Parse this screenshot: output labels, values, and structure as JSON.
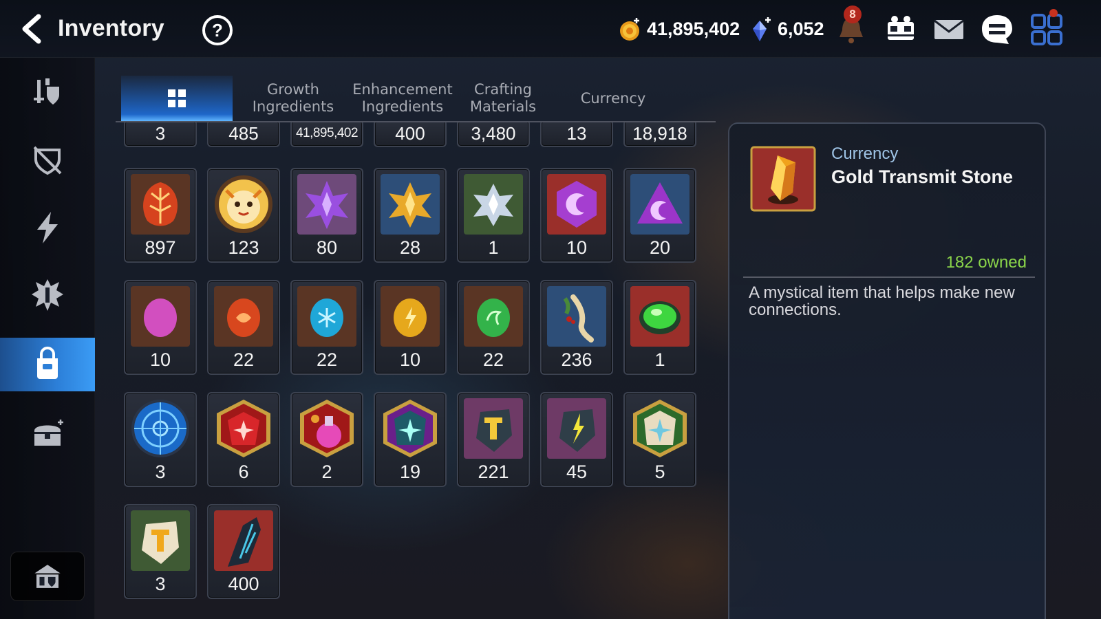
{
  "header": {
    "title": "Inventory",
    "gold": "41,895,402",
    "crystals": "6,052",
    "notification_count": "8"
  },
  "tabs": [
    {
      "label": "",
      "icon": "grid-all-icon",
      "active": true
    },
    {
      "label": "Growth\nIngredients"
    },
    {
      "label": "Enhancement\nIngredients"
    },
    {
      "label": "Crafting\nMaterials"
    },
    {
      "label": "Currency"
    }
  ],
  "sidebar": [
    {
      "icon": "equipment-icon"
    },
    {
      "icon": "unequipped-icon"
    },
    {
      "icon": "lightning-icon"
    },
    {
      "icon": "artifact-icon"
    },
    {
      "icon": "bag-icon",
      "active": true
    },
    {
      "icon": "chest-icon"
    },
    {
      "icon": "storage-icon"
    }
  ],
  "items": [
    {
      "name": "item-1",
      "count": "3",
      "icon": "partial-item"
    },
    {
      "name": "item-2",
      "count": "485",
      "icon": "partial-item"
    },
    {
      "name": "item-3",
      "count": "41,895,402",
      "icon": "partial-item"
    },
    {
      "name": "item-4",
      "count": "400",
      "icon": "partial-item"
    },
    {
      "name": "item-5",
      "count": "3,480",
      "icon": "partial-item"
    },
    {
      "name": "item-6",
      "count": "13",
      "icon": "partial-item"
    },
    {
      "name": "item-7",
      "count": "18,918",
      "icon": "partial-item"
    },
    {
      "count": "897",
      "icon": "red-leaf-rune"
    },
    {
      "count": "123",
      "icon": "phantasma-face-token"
    },
    {
      "count": "80",
      "icon": "purple-crystal-flower"
    },
    {
      "count": "28",
      "icon": "gold-crystal-flower"
    },
    {
      "count": "1",
      "icon": "silver-crystal-flower"
    },
    {
      "count": "10",
      "icon": "purple-moon-gem"
    },
    {
      "count": "20",
      "icon": "purple-triangle-gem"
    },
    {
      "count": "10",
      "icon": "pink-rune-stone"
    },
    {
      "count": "22",
      "icon": "red-rune-stone"
    },
    {
      "count": "22",
      "icon": "blue-rune-stone"
    },
    {
      "count": "10",
      "icon": "gold-rune-stone"
    },
    {
      "count": "22",
      "icon": "green-rune-stone"
    },
    {
      "count": "236",
      "icon": "ginseng-root"
    },
    {
      "count": "1",
      "icon": "green-orb-gem"
    },
    {
      "count": "3",
      "icon": "blue-seal-disk"
    },
    {
      "count": "6",
      "icon": "red-star-charm"
    },
    {
      "count": "2",
      "icon": "pink-potion-charm"
    },
    {
      "count": "19",
      "icon": "purple-star-charm"
    },
    {
      "count": "221",
      "icon": "hammer-stone"
    },
    {
      "count": "45",
      "icon": "lightning-stone"
    },
    {
      "count": "5",
      "icon": "green-star-charm"
    },
    {
      "count": "3",
      "icon": "gold-hammer-stone"
    },
    {
      "count": "400",
      "icon": "dark-crystal-shard"
    }
  ],
  "detail": {
    "category": "Currency",
    "name": "Gold Transmit Stone",
    "owned": "182 owned",
    "description": "A mystical item that helps make new connections."
  },
  "colors": {
    "accent_blue": "#2c7fd8",
    "owned_green": "#8ad44a",
    "category_blue": "#9fc4e6"
  }
}
